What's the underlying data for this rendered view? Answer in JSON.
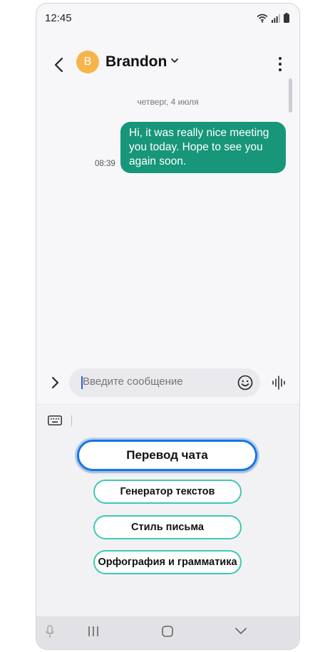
{
  "status_bar": {
    "time": "12:45"
  },
  "header": {
    "avatar_letter": "B",
    "contact_name": "Brandon"
  },
  "chat": {
    "date_separator": "четверг, 4 июля",
    "messages": [
      {
        "text": "Hi, it was really nice meeting you today. Hope to see you again soon.",
        "time": "08:39",
        "direction": "outgoing"
      }
    ]
  },
  "composer": {
    "placeholder": "Введите сообщение"
  },
  "ai_panel": {
    "primary_button": "Перевод чата",
    "buttons": [
      "Генератор текстов",
      "Стиль письма",
      "Орфография и грамматика"
    ]
  },
  "colors": {
    "bubble": "#17967a",
    "accent": "#1577e6",
    "outline": "#3fc7b8",
    "avatar": "#f5b54a"
  }
}
